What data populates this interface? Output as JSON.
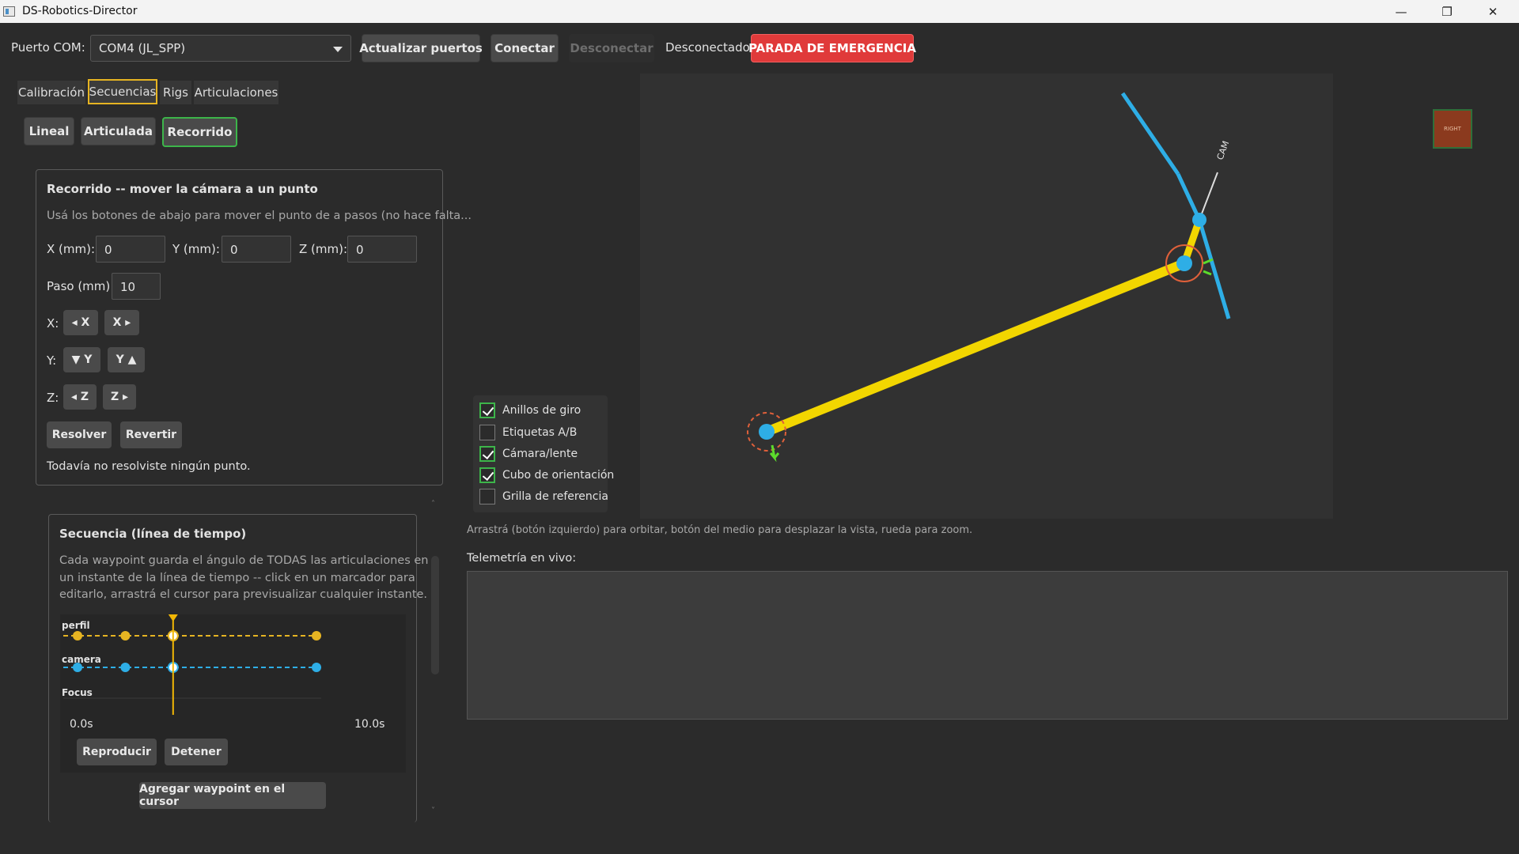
{
  "window": {
    "title": "DS-Robotics-Director",
    "minimize": "—",
    "maximize": "❐",
    "close": "✕"
  },
  "toolbar": {
    "com_label": "Puerto COM:",
    "com_value": "COM4 (JL_SPP)",
    "refresh_label": "Actualizar puertos",
    "connect_label": "Conectar",
    "disconnect_label": "Desconectar",
    "status_text": "Desconectado",
    "estop_label": "PARADA DE EMERGENCIA",
    "estop_color": "#e03a3a"
  },
  "tabs": [
    {
      "label": "Calibración",
      "active": false
    },
    {
      "label": "Secuencias",
      "active": true
    },
    {
      "label": "Rigs",
      "active": false
    },
    {
      "label": "Articulaciones",
      "active": false
    }
  ],
  "subtabs": [
    {
      "label": "Lineal"
    },
    {
      "label": "Articulada"
    },
    {
      "label": "Recorrido",
      "active": true
    }
  ],
  "recorrido": {
    "title": "Recorrido -- mover la cámara a un punto",
    "hint": "Usá los botones de abajo para mover el punto de a pasos (no hace falta...",
    "x_label": "X (mm):",
    "x_value": "0",
    "y_label": "Y (mm):",
    "y_value": "0",
    "z_label": "Z (mm):",
    "z_value": "0",
    "step_label": "Paso (mm):",
    "step_value": "10",
    "x_row_label": "X:",
    "x_minus": "◂ X",
    "x_plus": "X ▸",
    "y_row_label": "Y:",
    "y_minus": "▼ Y",
    "y_plus": "Y ▲",
    "z_row_label": "Z:",
    "z_minus": "◂ Z",
    "z_plus": "Z ▸",
    "solve_label": "Resolver",
    "revert_label": "Revertir",
    "status": "Todavía no resolviste ningún punto."
  },
  "secuencia": {
    "title": "Secuencia (línea de tiempo)",
    "desc_1": "Cada waypoint guarda el ángulo de TODAS las articulaciones en",
    "desc_2": "un instante de la línea de tiempo -- click en un marcador para",
    "desc_3": "editarlo, arrastrá el cursor para previsualizar cualquier instante.",
    "tracks": [
      {
        "name": "perfil",
        "color": "#e6b422",
        "waypoints": [
          0.0,
          2.0,
          4.0,
          10.0
        ]
      },
      {
        "name": "camera",
        "color": "#2eaee6",
        "waypoints": [
          0.0,
          2.0,
          4.0,
          10.0
        ]
      },
      {
        "name": "Focus",
        "color": "#888888",
        "waypoints": []
      }
    ],
    "cursor_time": 4.0,
    "time_start": "0.0s",
    "time_end": "10.0s",
    "play_label": "Reproducir",
    "stop_label": "Detener",
    "add_label": "Agregar waypoint en el cursor"
  },
  "viewport": {
    "options": [
      {
        "label": "Anillos de giro",
        "checked": true
      },
      {
        "label": "Etiquetas A/B",
        "checked": false
      },
      {
        "label": "Cámara/lente",
        "checked": true
      },
      {
        "label": "Cubo de orientación",
        "checked": true
      },
      {
        "label": "Grilla de referencia",
        "checked": false
      }
    ],
    "cam_label": "CAM",
    "cube_label": "RIGHT",
    "arm_color": "#f2d600",
    "joint_color": "#2eaee6",
    "help": "Arrastrá (botón izquierdo) para orbitar, botón del medio para desplazar la vista, rueda para zoom."
  },
  "telemetry": {
    "label": "Telemetría en vivo:"
  }
}
